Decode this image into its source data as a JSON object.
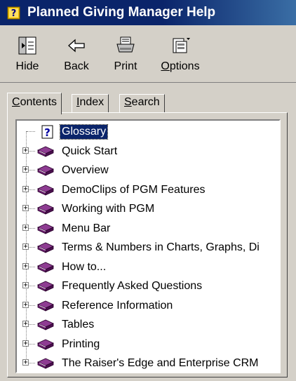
{
  "window": {
    "title": "Planned Giving Manager Help"
  },
  "toolbar": {
    "hide_label": "Hide",
    "back_label": "Back",
    "print_label": "Print",
    "options_label": "Options"
  },
  "tabs": [
    {
      "label": "Contents"
    },
    {
      "label": "Index"
    },
    {
      "label": "Search"
    }
  ],
  "tree": {
    "selected": "Glossary",
    "items": [
      {
        "label": "Glossary",
        "icon": "question-page-icon",
        "expandable": false
      },
      {
        "label": "Quick Start",
        "icon": "book-icon",
        "expandable": true
      },
      {
        "label": "Overview",
        "icon": "book-icon",
        "expandable": true
      },
      {
        "label": "DemoClips of PGM Features",
        "icon": "book-icon",
        "expandable": true
      },
      {
        "label": "Working with PGM",
        "icon": "book-icon",
        "expandable": true
      },
      {
        "label": "Menu Bar",
        "icon": "book-icon",
        "expandable": true
      },
      {
        "label": "Terms & Numbers in Charts, Graphs, Di",
        "icon": "book-icon",
        "expandable": true
      },
      {
        "label": "How to...",
        "icon": "book-icon",
        "expandable": true
      },
      {
        "label": "Frequently Asked Questions",
        "icon": "book-icon",
        "expandable": true
      },
      {
        "label": "Reference Information",
        "icon": "book-icon",
        "expandable": true
      },
      {
        "label": "Tables",
        "icon": "book-icon",
        "expandable": true
      },
      {
        "label": "Printing",
        "icon": "book-icon",
        "expandable": true
      },
      {
        "label": "The Raiser's Edge and Enterprise CRM",
        "icon": "book-icon",
        "expandable": true
      }
    ]
  },
  "colors": {
    "title_bar": "#0a246a",
    "selection": "#0a246a",
    "book": "#6b1f6e",
    "face": "#d4d0c8"
  }
}
